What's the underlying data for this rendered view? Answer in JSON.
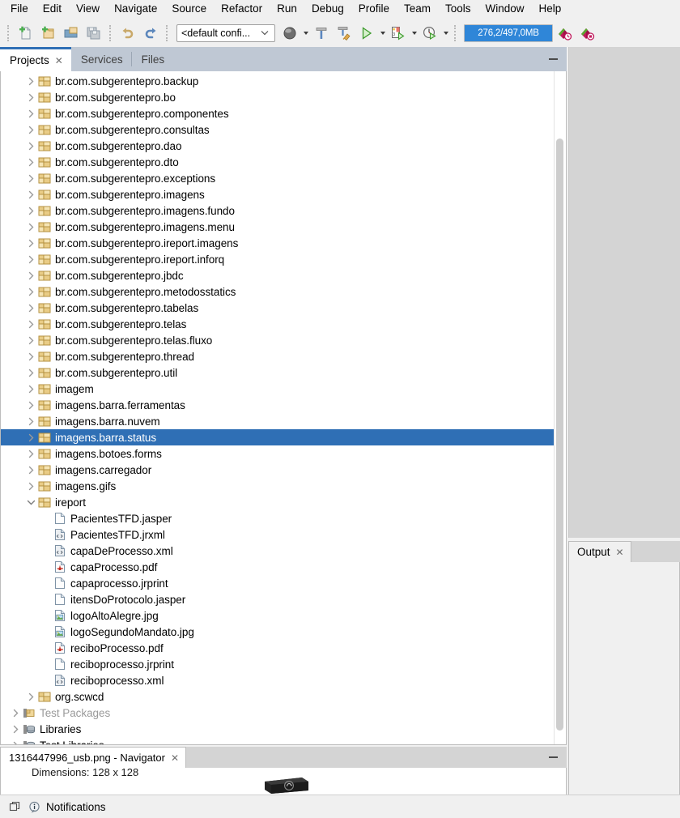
{
  "menubar": {
    "items": [
      "File",
      "Edit",
      "View",
      "Navigate",
      "Source",
      "Refactor",
      "Run",
      "Debug",
      "Profile",
      "Team",
      "Tools",
      "Window",
      "Help"
    ]
  },
  "toolbar": {
    "buttons": [
      {
        "name": "new-file-button",
        "icon": "new-file-icon"
      },
      {
        "name": "new-project-button",
        "icon": "new-project-icon"
      },
      {
        "name": "open-project-button",
        "icon": "open-project-icon"
      },
      {
        "name": "save-all-button",
        "icon": "save-all-icon"
      }
    ],
    "undo_label": "undo-icon",
    "redo_label": "redo-icon",
    "config_combo_value": "<default confi...",
    "run_buttons": [
      {
        "name": "set-browser-button",
        "icon": "browser-icon"
      },
      {
        "name": "build-project-button",
        "icon": "hammer-icon"
      },
      {
        "name": "clean-and-build-button",
        "icon": "hammer-broom-icon"
      },
      {
        "name": "run-project-button",
        "icon": "play-icon"
      },
      {
        "name": "debug-project-button",
        "icon": "debug-icon"
      },
      {
        "name": "profile-project-button",
        "icon": "profile-icon"
      }
    ],
    "memory": {
      "text": "276,2/497,0MB",
      "used_mb": 276.2,
      "total_mb": 497.0,
      "fill_percent": 100,
      "fill_color": "#2f86d8"
    },
    "right_icons": [
      {
        "name": "profile-history-icon"
      },
      {
        "name": "profile-stop-icon"
      }
    ]
  },
  "projects_panel": {
    "tabs": [
      {
        "label": "Projects",
        "active": true,
        "closable": true
      },
      {
        "label": "Services",
        "active": false,
        "closable": false
      },
      {
        "label": "Files",
        "active": false,
        "closable": false
      }
    ],
    "tree": [
      {
        "label": "br.com.subgerentepro.backup",
        "icon": "package-icon",
        "indent": 1,
        "twisty": "collapsed",
        "selected": false,
        "dim": false
      },
      {
        "label": "br.com.subgerentepro.bo",
        "icon": "package-icon",
        "indent": 1,
        "twisty": "collapsed",
        "selected": false,
        "dim": false
      },
      {
        "label": "br.com.subgerentepro.componentes",
        "icon": "package-icon",
        "indent": 1,
        "twisty": "collapsed",
        "selected": false,
        "dim": false
      },
      {
        "label": "br.com.subgerentepro.consultas",
        "icon": "package-icon",
        "indent": 1,
        "twisty": "collapsed",
        "selected": false,
        "dim": false
      },
      {
        "label": "br.com.subgerentepro.dao",
        "icon": "package-icon",
        "indent": 1,
        "twisty": "collapsed",
        "selected": false,
        "dim": false
      },
      {
        "label": "br.com.subgerentepro.dto",
        "icon": "package-icon",
        "indent": 1,
        "twisty": "collapsed",
        "selected": false,
        "dim": false
      },
      {
        "label": "br.com.subgerentepro.exceptions",
        "icon": "package-icon",
        "indent": 1,
        "twisty": "collapsed",
        "selected": false,
        "dim": false
      },
      {
        "label": "br.com.subgerentepro.imagens",
        "icon": "package-icon",
        "indent": 1,
        "twisty": "collapsed",
        "selected": false,
        "dim": false
      },
      {
        "label": "br.com.subgerentepro.imagens.fundo",
        "icon": "package-icon",
        "indent": 1,
        "twisty": "collapsed",
        "selected": false,
        "dim": false
      },
      {
        "label": "br.com.subgerentepro.imagens.menu",
        "icon": "package-icon",
        "indent": 1,
        "twisty": "collapsed",
        "selected": false,
        "dim": false
      },
      {
        "label": "br.com.subgerentepro.ireport.imagens",
        "icon": "package-icon",
        "indent": 1,
        "twisty": "collapsed",
        "selected": false,
        "dim": false
      },
      {
        "label": "br.com.subgerentepro.ireport.inforq",
        "icon": "package-icon",
        "indent": 1,
        "twisty": "collapsed",
        "selected": false,
        "dim": false
      },
      {
        "label": "br.com.subgerentepro.jbdc",
        "icon": "package-icon",
        "indent": 1,
        "twisty": "collapsed",
        "selected": false,
        "dim": false
      },
      {
        "label": "br.com.subgerentepro.metodosstatics",
        "icon": "package-icon",
        "indent": 1,
        "twisty": "collapsed",
        "selected": false,
        "dim": false
      },
      {
        "label": "br.com.subgerentepro.tabelas",
        "icon": "package-icon",
        "indent": 1,
        "twisty": "collapsed",
        "selected": false,
        "dim": false
      },
      {
        "label": "br.com.subgerentepro.telas",
        "icon": "package-icon",
        "indent": 1,
        "twisty": "collapsed",
        "selected": false,
        "dim": false
      },
      {
        "label": "br.com.subgerentepro.telas.fluxo",
        "icon": "package-icon",
        "indent": 1,
        "twisty": "collapsed",
        "selected": false,
        "dim": false
      },
      {
        "label": "br.com.subgerentepro.thread",
        "icon": "package-icon",
        "indent": 1,
        "twisty": "collapsed",
        "selected": false,
        "dim": false
      },
      {
        "label": "br.com.subgerentepro.util",
        "icon": "package-icon",
        "indent": 1,
        "twisty": "collapsed",
        "selected": false,
        "dim": false
      },
      {
        "label": "imagem",
        "icon": "package-icon",
        "indent": 1,
        "twisty": "collapsed",
        "selected": false,
        "dim": false
      },
      {
        "label": "imagens.barra.ferramentas",
        "icon": "package-icon",
        "indent": 1,
        "twisty": "collapsed",
        "selected": false,
        "dim": false
      },
      {
        "label": "imagens.barra.nuvem",
        "icon": "package-icon",
        "indent": 1,
        "twisty": "collapsed",
        "selected": false,
        "dim": false
      },
      {
        "label": "imagens.barra.status",
        "icon": "package-icon",
        "indent": 1,
        "twisty": "collapsed",
        "selected": true,
        "dim": false
      },
      {
        "label": "imagens.botoes.forms",
        "icon": "package-icon",
        "indent": 1,
        "twisty": "collapsed",
        "selected": false,
        "dim": false
      },
      {
        "label": "imagens.carregador",
        "icon": "package-icon",
        "indent": 1,
        "twisty": "collapsed",
        "selected": false,
        "dim": false
      },
      {
        "label": "imagens.gifs",
        "icon": "package-icon",
        "indent": 1,
        "twisty": "collapsed",
        "selected": false,
        "dim": false
      },
      {
        "label": "ireport",
        "icon": "package-icon",
        "indent": 1,
        "twisty": "expanded",
        "selected": false,
        "dim": false
      },
      {
        "label": "PacientesTFD.jasper",
        "icon": "file-icon",
        "indent": 2,
        "twisty": "none",
        "selected": false,
        "dim": false
      },
      {
        "label": "PacientesTFD.jrxml",
        "icon": "xml-icon",
        "indent": 2,
        "twisty": "none",
        "selected": false,
        "dim": false
      },
      {
        "label": "capaDeProcesso.xml",
        "icon": "xml-icon",
        "indent": 2,
        "twisty": "none",
        "selected": false,
        "dim": false
      },
      {
        "label": "capaProcesso.pdf",
        "icon": "pdf-icon",
        "indent": 2,
        "twisty": "none",
        "selected": false,
        "dim": false
      },
      {
        "label": "capaprocesso.jrprint",
        "icon": "file-icon",
        "indent": 2,
        "twisty": "none",
        "selected": false,
        "dim": false
      },
      {
        "label": "itensDoProtocolo.jasper",
        "icon": "file-icon",
        "indent": 2,
        "twisty": "none",
        "selected": false,
        "dim": false
      },
      {
        "label": "logoAltoAlegre.jpg",
        "icon": "image-icon",
        "indent": 2,
        "twisty": "none",
        "selected": false,
        "dim": false
      },
      {
        "label": "logoSegundoMandato.jpg",
        "icon": "image-icon",
        "indent": 2,
        "twisty": "none",
        "selected": false,
        "dim": false
      },
      {
        "label": "reciboProcesso.pdf",
        "icon": "pdf-icon",
        "indent": 2,
        "twisty": "none",
        "selected": false,
        "dim": false
      },
      {
        "label": "reciboprocesso.jrprint",
        "icon": "file-icon",
        "indent": 2,
        "twisty": "none",
        "selected": false,
        "dim": false
      },
      {
        "label": "reciboprocesso.xml",
        "icon": "xml-icon",
        "indent": 2,
        "twisty": "none",
        "selected": false,
        "dim": false
      },
      {
        "label": "org.scwcd",
        "icon": "package-icon",
        "indent": 1,
        "twisty": "collapsed",
        "selected": false,
        "dim": false
      },
      {
        "label": "Test Packages",
        "icon": "test-packages-icon",
        "indent": 0,
        "twisty": "collapsed",
        "selected": false,
        "dim": true
      },
      {
        "label": "Libraries",
        "icon": "libraries-icon",
        "indent": 0,
        "twisty": "collapsed",
        "selected": false,
        "dim": false
      },
      {
        "label": "Test Libraries",
        "icon": "libraries-icon",
        "indent": 0,
        "twisty": "collapsed",
        "selected": false,
        "dim": false
      }
    ],
    "scrollbar": {
      "thumb_top_pct": 10,
      "thumb_height_pct": 88
    }
  },
  "navigator_panel": {
    "tab_label": "1316447996_usb.png - Navigator",
    "dimensions_text": "Dimensions: 128 x 128",
    "preview_icon": "usb-drive-image"
  },
  "output_panel": {
    "tab_label": "Output"
  },
  "statusbar": {
    "notifications_label": "Notifications",
    "window_icon": "window-restore-icon",
    "info_icon": "info-circle-icon"
  },
  "colors": {
    "accent": "#2f6fb5",
    "tabstrip": "#bfc8d4",
    "selection": "#2f6fb5",
    "memory_fill": "#2f86d8"
  }
}
